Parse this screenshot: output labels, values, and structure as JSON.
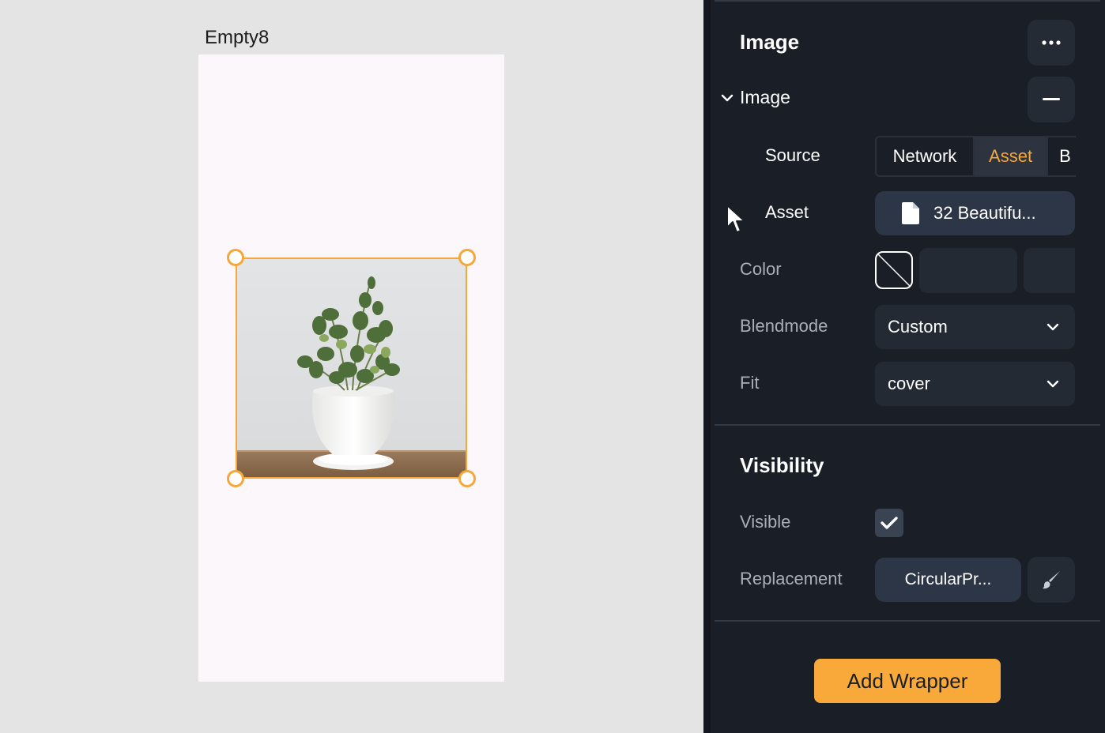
{
  "canvas": {
    "frame_label": "Empty8",
    "background_color": "#e4e4e4",
    "frame_color": "#fcf7fb",
    "selection_color": "#f6a73a"
  },
  "panel": {
    "image_section": {
      "title": "Image",
      "more_icon": "ellipsis-icon",
      "subsection_label": "Image",
      "collapse_icon": "chevron-down-icon",
      "remove_icon": "minus-icon",
      "source_label": "Source",
      "source_options": [
        "Network",
        "Asset",
        "B"
      ],
      "source_selected": "Asset",
      "asset_label": "Asset",
      "asset_value": "32 Beautifu...",
      "asset_icon": "file-icon",
      "color_label": "Color",
      "blendmode_label": "Blendmode",
      "blendmode_value": "Custom",
      "fit_label": "Fit",
      "fit_value": "cover"
    },
    "visibility_section": {
      "title": "Visibility",
      "visible_label": "Visible",
      "visible_checked": true,
      "replacement_label": "Replacement",
      "replacement_value": "CircularPr...",
      "brush_icon": "brush-icon"
    },
    "add_wrapper_label": "Add Wrapper",
    "accent_color": "#f8a93a",
    "background_color": "#1a1f27"
  }
}
